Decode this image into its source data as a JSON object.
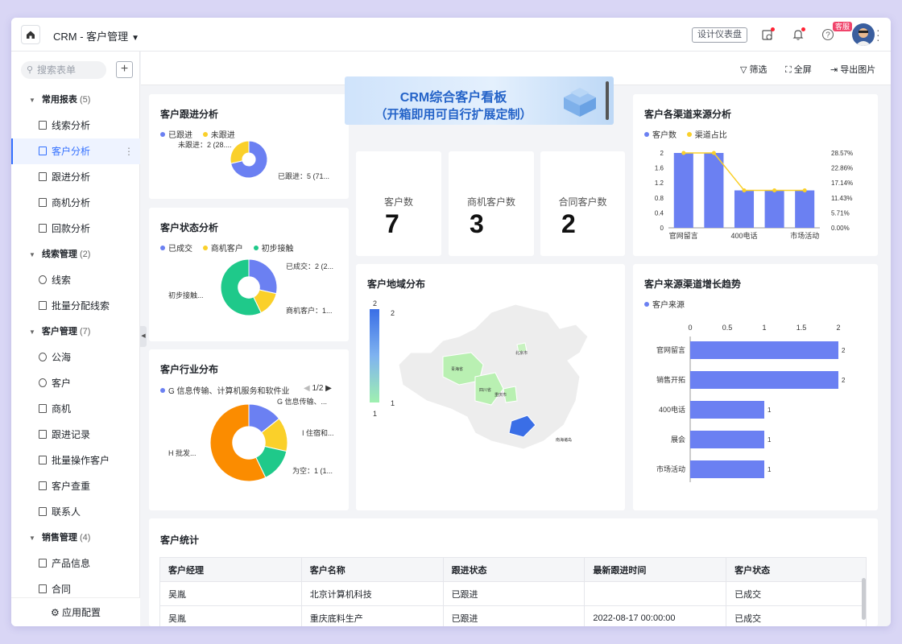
{
  "app": {
    "title": "CRM - 客户管理"
  },
  "topbar": {
    "design_label": "设计仪表盘",
    "kefu_label": "客服"
  },
  "sidebar": {
    "search_placeholder": "搜索表单",
    "app_config_label": "应用配置",
    "groups": [
      {
        "label": "常用报表",
        "count": "(5)",
        "items": [
          "线索分析",
          "客户分析",
          "跟进分析",
          "商机分析",
          "回款分析"
        ]
      },
      {
        "label": "线索管理",
        "count": "(2)",
        "items": [
          "线索",
          "批量分配线索"
        ]
      },
      {
        "label": "客户管理",
        "count": "(7)",
        "items": [
          "公海",
          "客户",
          "商机",
          "跟进记录",
          "批量操作客户",
          "客户查重",
          "联系人"
        ]
      },
      {
        "label": "销售管理",
        "count": "(4)",
        "items": [
          "产品信息",
          "合同"
        ]
      }
    ],
    "active_item": "客户分析"
  },
  "toolbar": {
    "filter": "筛选",
    "fullscreen": "全屏",
    "export": "导出图片"
  },
  "banner": {
    "line1": "CRM综合客户看板",
    "line2": "（开箱即用可自行扩展定制）"
  },
  "stats": [
    {
      "label": "客户数",
      "value": "7"
    },
    {
      "label": "商机客户数",
      "value": "3"
    },
    {
      "label": "合同客户数",
      "value": "2"
    }
  ],
  "colors": {
    "blue": "#6b80f2",
    "yellow": "#fad02a",
    "green": "#1fc98a",
    "orange": "#fb8c00",
    "accent": "#3370ff"
  },
  "cards": {
    "follow": {
      "title": "客户跟进分析",
      "legend": [
        "已跟进",
        "未跟进"
      ],
      "label_a": "已跟进：5 (71...",
      "label_b": "未跟进：2 (28...."
    },
    "status": {
      "title": "客户状态分析",
      "legend": [
        "已成交",
        "商机客户",
        "初步接触"
      ],
      "label_a": "已成交：2 (2...",
      "label_b": "商机客户：1...",
      "label_c": "初步接触..."
    },
    "industry": {
      "title": "客户行业分布",
      "legend": "G 信息传输、计算机服务和软件业",
      "pager": "1/2",
      "label_a": "G 信息传输、...",
      "label_b": "I 住宿和...",
      "label_c": "为空：1 (1...",
      "label_d": "H 批发..."
    },
    "channel": {
      "title": "客户各渠道来源分析",
      "legend": [
        "客户数",
        "渠道占比"
      ],
      "y_ticks": [
        "2",
        "1.6",
        "1.2",
        "0.8",
        "0.4",
        "0"
      ],
      "y2_ticks": [
        "28.57%",
        "22.86%",
        "17.14%",
        "11.43%",
        "5.71%",
        "0.00%"
      ],
      "x_labels": [
        "官网留言",
        "400电话",
        "市场活动"
      ]
    },
    "region": {
      "title": "客户地域分布",
      "scale_max": "2",
      "scale_min": "1",
      "scale_top": "2",
      "scale_bottom": "1",
      "regions": [
        "青海省",
        "四川省",
        "重庆市",
        "北京市",
        "南海诸岛"
      ]
    },
    "trend": {
      "title": "客户来源渠道增长趋势",
      "legend": "客户来源",
      "x_ticks": [
        "0",
        "0.5",
        "1",
        "1.5",
        "2"
      ]
    },
    "table": {
      "title": "客户统计",
      "columns": [
        "客户经理",
        "客户名称",
        "跟进状态",
        "最新跟进时间",
        "客户状态"
      ],
      "rows": [
        [
          "吴胤",
          "北京计算机科技",
          "已跟进",
          "",
          "已成交"
        ],
        [
          "吴胤",
          "重庆底料生产",
          "已跟进",
          "2022-08-17 00:00:00",
          "已成交"
        ]
      ]
    }
  },
  "chart_data": [
    {
      "type": "pie",
      "title": "客户跟进分析",
      "categories": [
        "已跟进",
        "未跟进"
      ],
      "values": [
        5,
        2
      ]
    },
    {
      "type": "pie",
      "title": "客户状态分析",
      "categories": [
        "已成交",
        "商机客户",
        "初步接触"
      ],
      "values": [
        2,
        1,
        4
      ]
    },
    {
      "type": "pie",
      "title": "客户行业分布",
      "categories": [
        "G 信息传输、计算机服务和软件业",
        "I 住宿和...",
        "为空",
        "H 批发..."
      ],
      "values": [
        1,
        1,
        1,
        4
      ]
    },
    {
      "type": "bar",
      "title": "客户各渠道来源分析",
      "categories": [
        "官网留言",
        "销售开拓",
        "400电话",
        "展会",
        "市场活动"
      ],
      "series": [
        {
          "name": "客户数",
          "type": "bar",
          "values": [
            2,
            2,
            1,
            1,
            1
          ]
        },
        {
          "name": "渠道占比",
          "type": "line",
          "values": [
            28.57,
            28.57,
            14.29,
            14.29,
            14.29
          ]
        }
      ],
      "ylim": [
        0,
        2
      ],
      "y2lim": [
        0,
        28.57
      ]
    },
    {
      "type": "bar",
      "title": "客户来源渠道增长趋势",
      "orientation": "horizontal",
      "categories": [
        "官网留言",
        "销售开拓",
        "400电话",
        "展会",
        "市场活动"
      ],
      "series": [
        {
          "name": "客户来源",
          "values": [
            2,
            2,
            1,
            1,
            1
          ]
        }
      ],
      "xlim": [
        0,
        2
      ]
    }
  ]
}
